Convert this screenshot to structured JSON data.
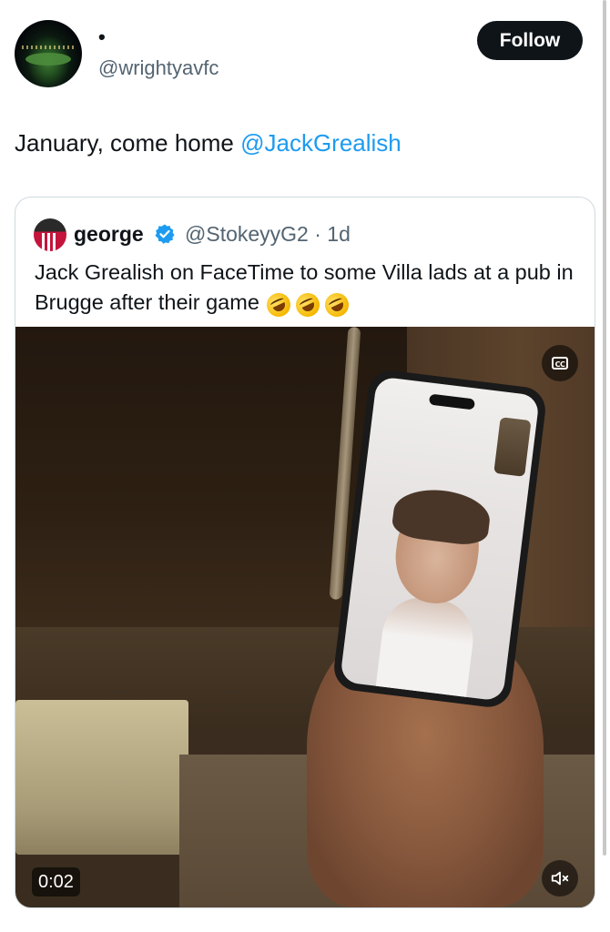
{
  "author": {
    "display_name": "•",
    "handle": "@wrightyavfc",
    "avatar_icon": "stadium-avatar"
  },
  "follow_label": "Follow",
  "tweet": {
    "text_prefix": "January, come home ",
    "mention": "@JackGrealish"
  },
  "quoted": {
    "display_name": "george",
    "handle_time": "@StokeyyG2 · 1d",
    "text": "Jack Grealish on FaceTime to some Villa lads at a pub in Brugge after their game",
    "emoji": [
      "rolling-on-floor-laughing",
      "rolling-on-floor-laughing",
      "rolling-on-floor-laughing"
    ],
    "video": {
      "duration": "0:02",
      "cc_label": "CC"
    }
  },
  "colors": {
    "accent": "#1d9bf0",
    "verified": "#1d9bf0",
    "follow_bg": "#0f1419"
  }
}
